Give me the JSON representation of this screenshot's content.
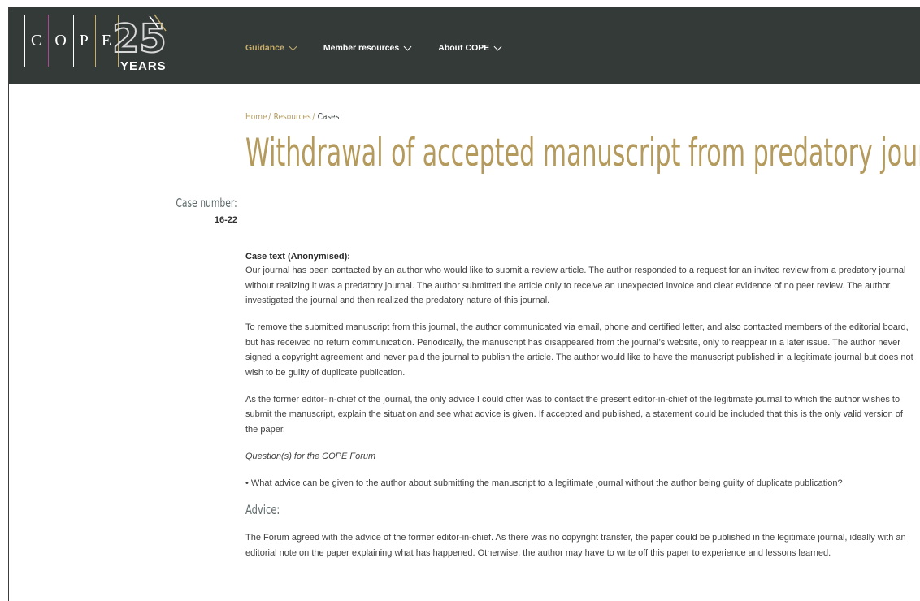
{
  "brand": {
    "letters": [
      "C",
      "O",
      "P",
      "E"
    ],
    "badge_number": "25",
    "badge_word": "YEARS",
    "bar_colors": [
      "#ffffff",
      "#c6ad6c",
      "#a64b8c",
      "#ffffff",
      "#c6ad6c"
    ]
  },
  "nav": {
    "items": [
      {
        "label": "Guidance",
        "active": true
      },
      {
        "label": "Member resources",
        "active": false
      },
      {
        "label": "About COPE",
        "active": false
      }
    ]
  },
  "breadcrumb": {
    "home": "Home",
    "resources": "Resources",
    "current": "Cases",
    "separator": "/"
  },
  "page": {
    "title": "Withdrawal of accepted manuscript from predatory journal",
    "case_number_label": "Case number:",
    "case_number": "16-22"
  },
  "content": {
    "case_text_heading": "Case text (Anonymised):",
    "paragraph_1": "Our journal has been contacted by an author who would like to submit a review article. The author responded to a request for an invited review from a predatory journal without realizing it was a predatory journal. The author submitted the article only to receive an unexpected invoice and clear evidence of no peer review. The author investigated the journal and then realized the predatory nature of this journal.",
    "paragraph_2": "To remove the submitted manuscript from this journal, the author communicated via email, phone and certified letter, and also contacted members of the editorial board, but has received no return communication. Periodically, the manuscript has disappeared from the journal’s website, only to reappear in a later issue. The author never signed a copyright agreement and never paid the journal to publish the article. The author would like to have the manuscript published in a legitimate journal but does not wish to be guilty of duplicate publication.",
    "paragraph_3": "As the former editor-in-chief of the journal, the only advice I could offer was to contact the present editor-in-chief of the legitimate journal to which the author wishes to submit the manuscript, explain the situation and see what advice is given. If accepted and published, a statement could be included that this is the only valid version of the paper.",
    "questions_heading": "Question(s) for the COPE Forum",
    "question_1": "• What advice can be given to the author about submitting the manuscript to a legitimate journal without the author being guilty of duplicate publication?",
    "advice_heading": "Advice:",
    "advice_paragraph": "The Forum agreed with the advice of the former editor-in-chief. As there was no copyright transfer, the paper could be published in the legitimate journal, ideally with an editorial note on the paper explaining what has happened. Otherwise, the author may have to write off this paper to experience and lessons learned."
  },
  "colors": {
    "header_bg": "#333a37",
    "accent_gold": "#b49a5c",
    "heading_slate": "#5e6a6b"
  }
}
